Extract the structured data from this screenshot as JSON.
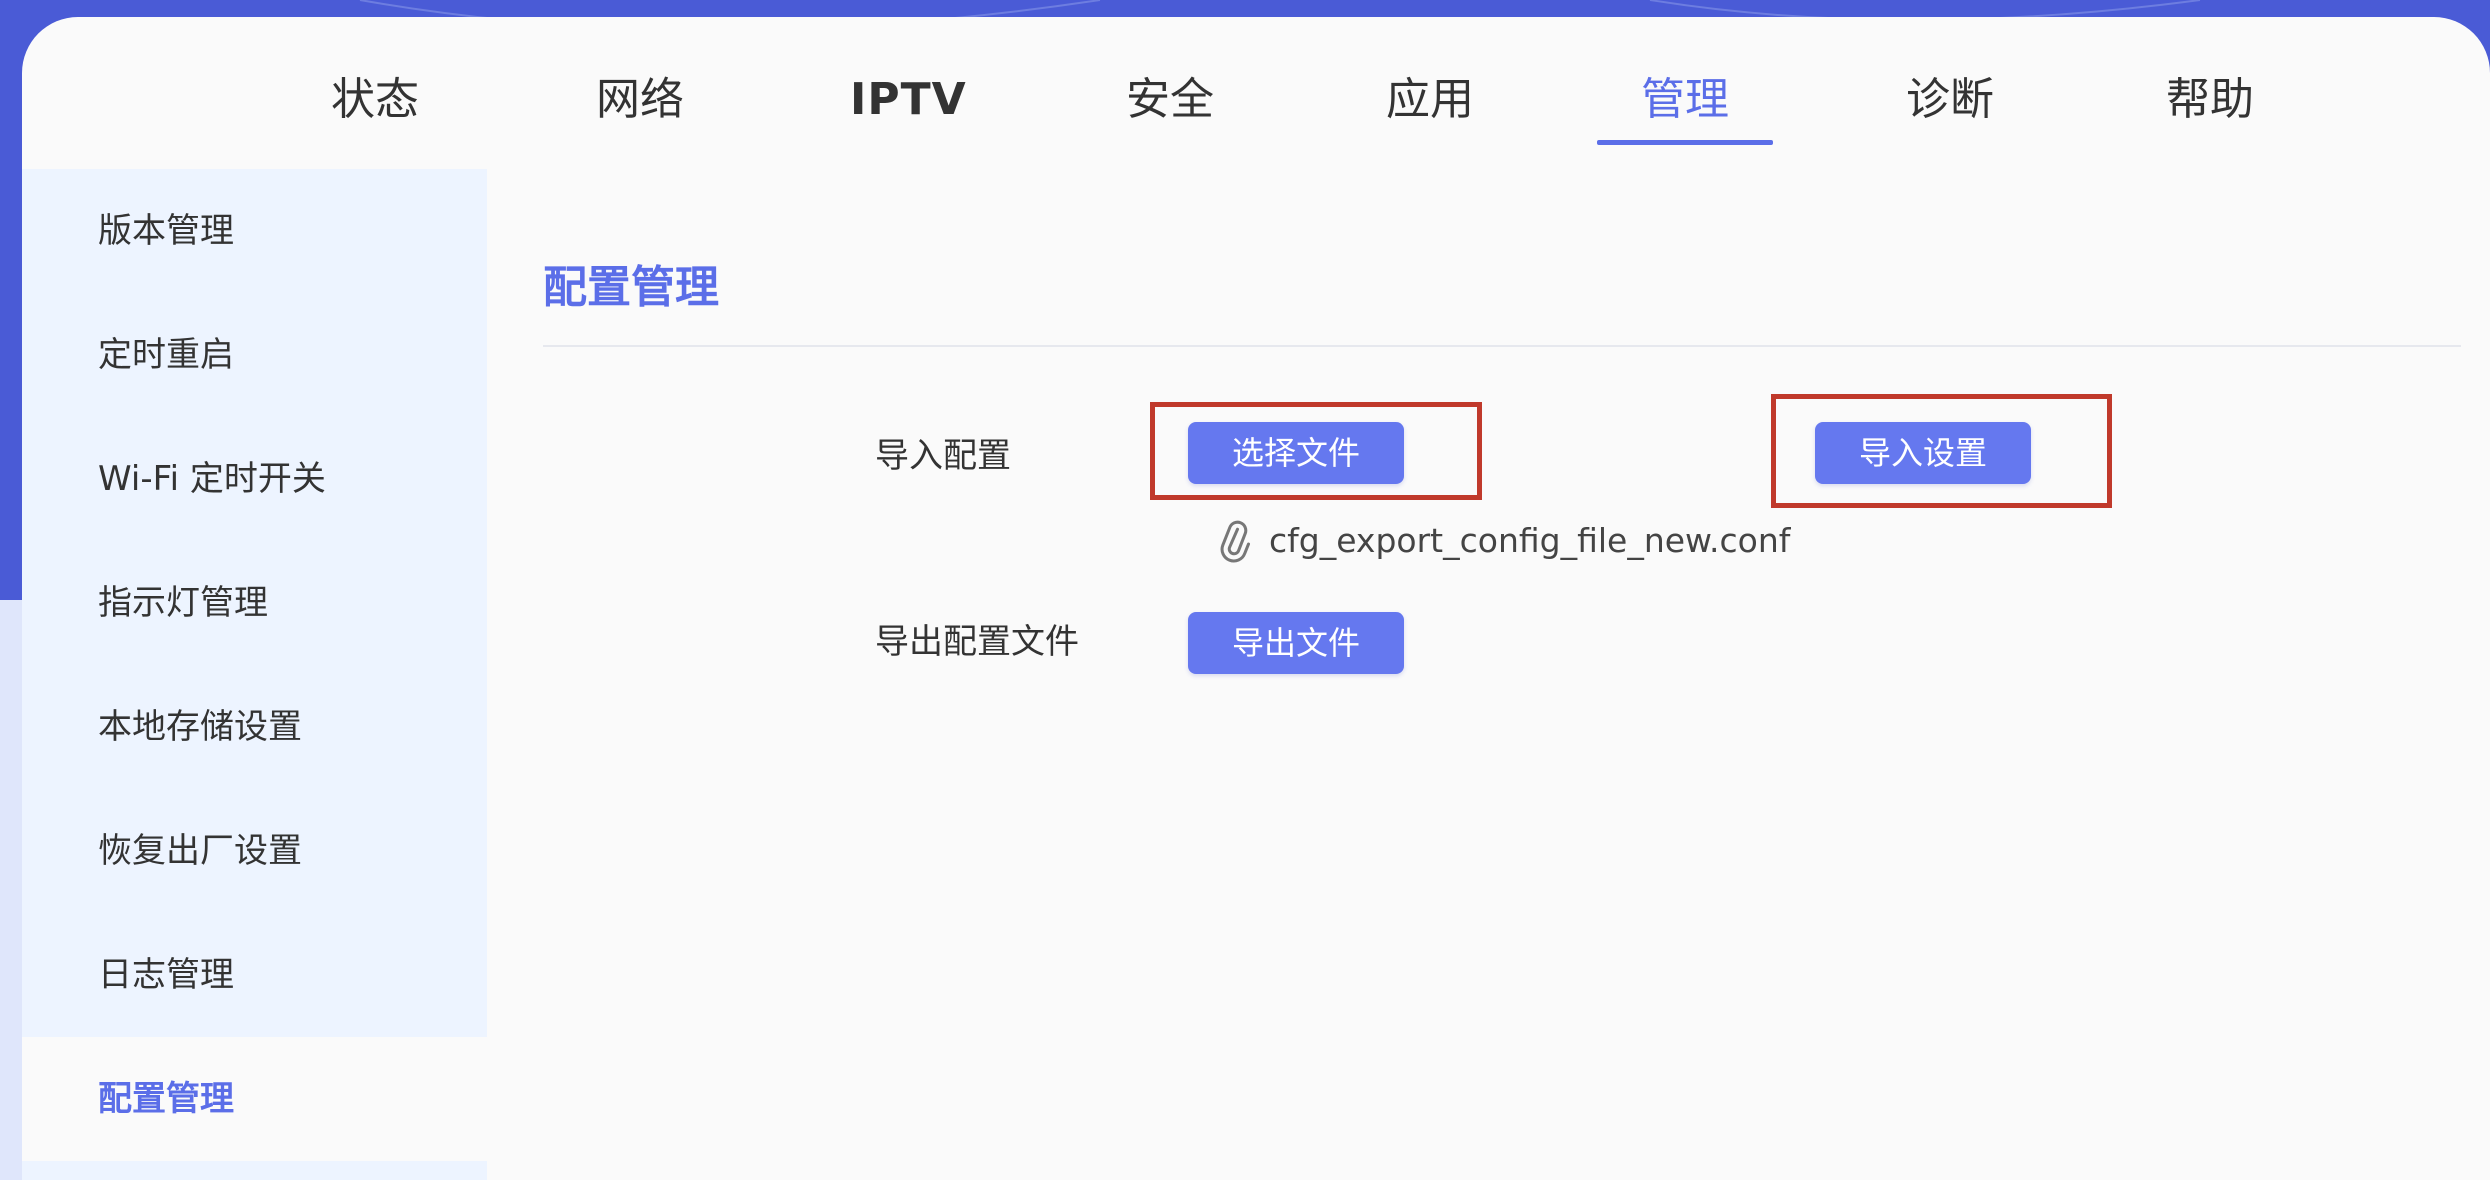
{
  "nav": {
    "items": [
      {
        "label": "状态"
      },
      {
        "label": "网络"
      },
      {
        "label": "IPTV"
      },
      {
        "label": "安全"
      },
      {
        "label": "应用"
      },
      {
        "label": "管理"
      },
      {
        "label": "诊断"
      },
      {
        "label": "帮助"
      }
    ],
    "active_index": 5
  },
  "sidebar": {
    "items": [
      {
        "label": "版本管理"
      },
      {
        "label": "定时重启"
      },
      {
        "label": "Wi-Fi 定时开关"
      },
      {
        "label": "指示灯管理"
      },
      {
        "label": "本地存储设置"
      },
      {
        "label": "恢复出厂设置"
      },
      {
        "label": "日志管理"
      },
      {
        "label": "配置管理"
      }
    ],
    "active_index": 7
  },
  "main": {
    "title": "配置管理",
    "import": {
      "label": "导入配置",
      "choose_button": "选择文件",
      "import_button": "导入设置",
      "selected_file": "cfg_export_config_file_new.conf",
      "file_icon": "paperclip-icon"
    },
    "export": {
      "label": "导出配置文件",
      "export_button": "导出文件"
    }
  },
  "colors": {
    "accent": "#5b6ee8",
    "button": "#6578ef",
    "sidebar_bg": "#edf4ff",
    "highlight_box": "#c0392b",
    "background": "#4a5bd6"
  }
}
